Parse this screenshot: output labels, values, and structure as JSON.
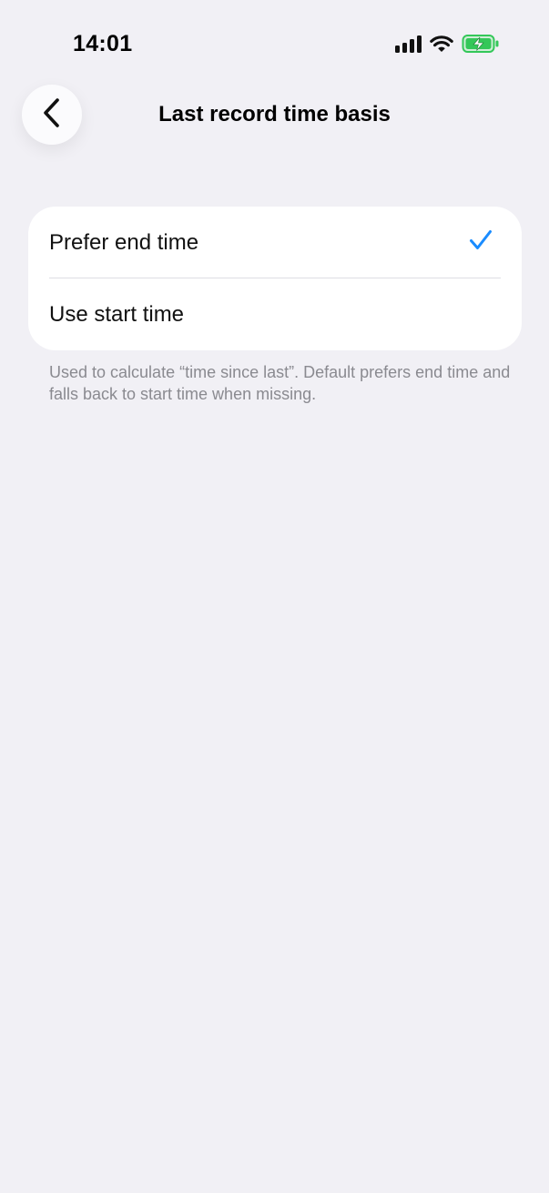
{
  "status_bar": {
    "time": "14:01"
  },
  "nav": {
    "back_icon": "chevron-left-icon",
    "title": "Last record time basis"
  },
  "options": [
    {
      "label": "Prefer end time",
      "selected": true
    },
    {
      "label": "Use start time",
      "selected": false
    }
  ],
  "footnote": "Used to calculate “time since last”. Default prefers end time and falls back to start time when missing.",
  "colors": {
    "background": "#f1f0f5",
    "card": "#ffffff",
    "accent_check": "#1a8cff",
    "battery_green": "#34c759",
    "secondary_text": "#8a8a90"
  }
}
